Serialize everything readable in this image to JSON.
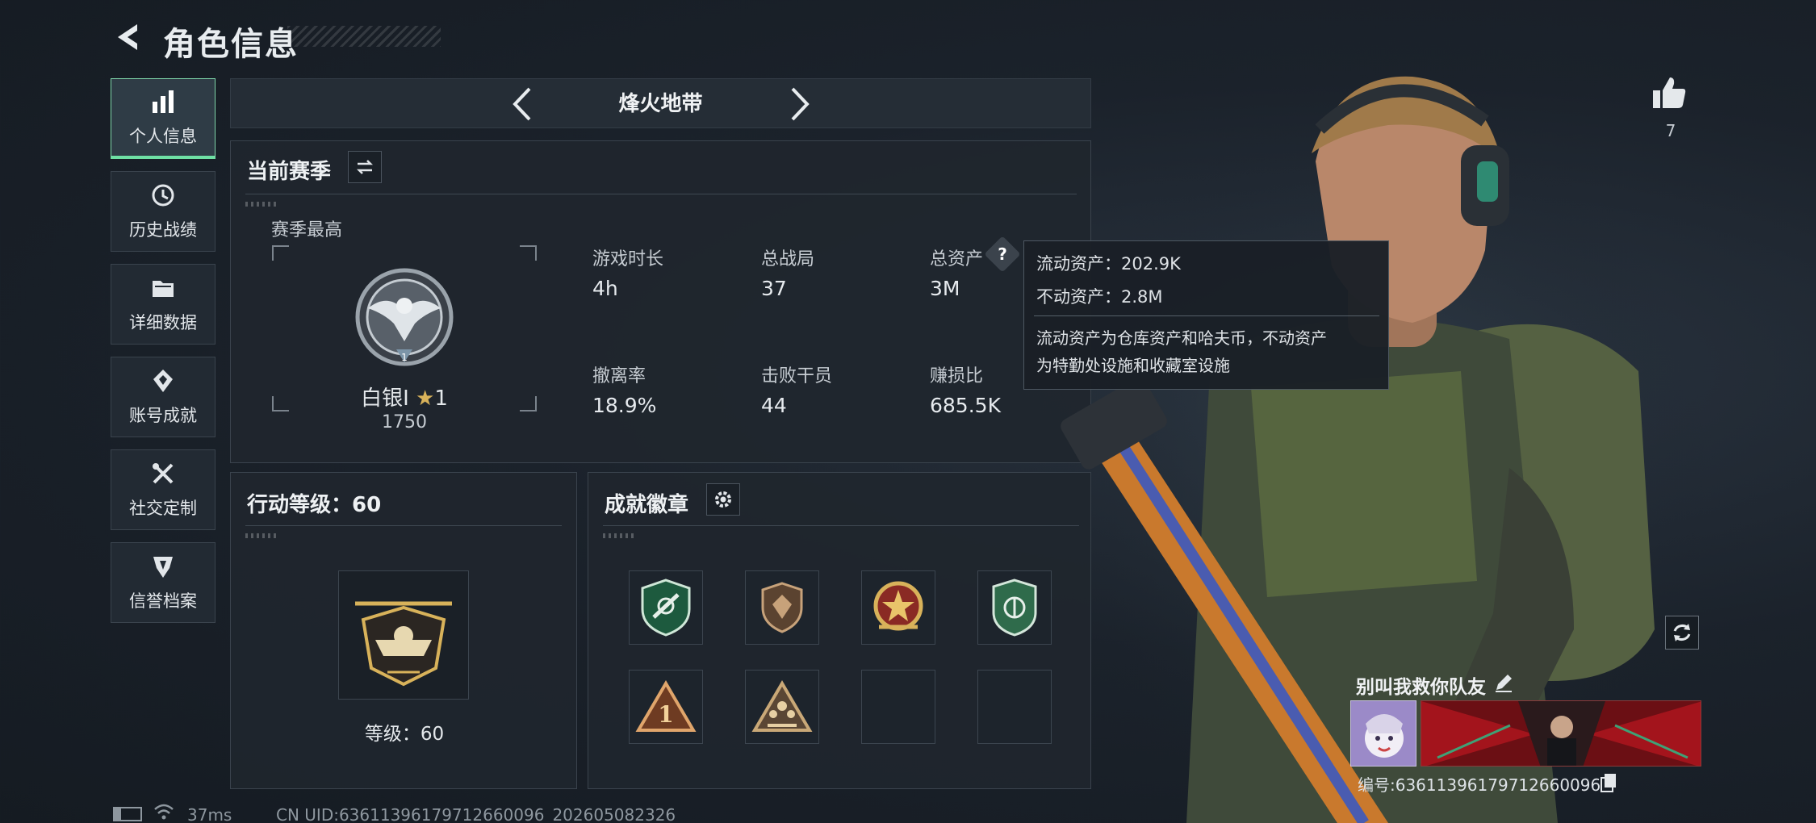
{
  "header": {
    "title": "角色信息"
  },
  "sidebar": {
    "items": [
      {
        "label": "个人信息",
        "icon": "bar-chart-icon"
      },
      {
        "label": "历史战绩",
        "icon": "history-icon"
      },
      {
        "label": "详细数据",
        "icon": "folder-icon"
      },
      {
        "label": "账号成就",
        "icon": "achievement-icon"
      },
      {
        "label": "社交定制",
        "icon": "tools-icon"
      },
      {
        "label": "信誉档案",
        "icon": "reputation-icon"
      }
    ]
  },
  "mode": {
    "title": "烽火地带"
  },
  "season": {
    "title": "当前赛季",
    "best_label": "赛季最高",
    "rank_name": "白银I",
    "rank_stars": "1",
    "rank_points": "1750",
    "stats": [
      {
        "label": "游戏时长",
        "value": "4h"
      },
      {
        "label": "总战局",
        "value": "37"
      },
      {
        "label": "总资产",
        "value": "3M"
      },
      {
        "label": "撤离率",
        "value": "18.9%"
      },
      {
        "label": "击败干员",
        "value": "44"
      },
      {
        "label": "赚损比",
        "value": "685.5K"
      }
    ]
  },
  "tooltip": {
    "liquid": "流动资产：202.9K",
    "fixed": "不动资产：2.8M",
    "note_line1": "流动资产为仓库资产和哈夫币，不动资产",
    "note_line2": "为特勤处设施和收藏室设施"
  },
  "action_level": {
    "title": "行动等级：60",
    "level_text": "等级：60"
  },
  "achievements": {
    "title": "成就徽章"
  },
  "likes": {
    "count": "7"
  },
  "player": {
    "nickname": "别叫我救你队友",
    "id_text": "编号:636113961797126600​96"
  },
  "footer": {
    "ping": "37ms",
    "uid_text": "CN UID:636113961797126600​96_202605082326"
  },
  "colors": {
    "accent": "#6ee0a4",
    "panel": "#1f262e",
    "gold": "#d8b25a"
  }
}
